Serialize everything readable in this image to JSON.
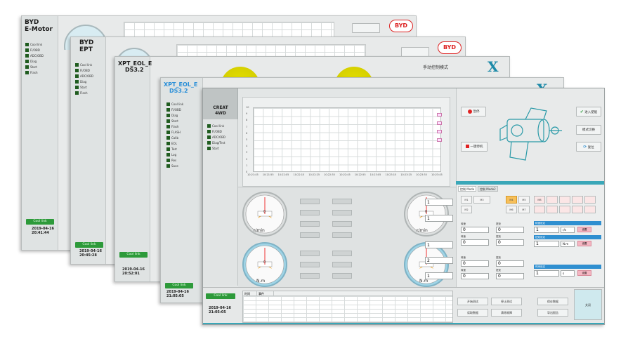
{
  "colors": {
    "accent_teal": "#3aa7b8",
    "status_green": "#2d9a3a",
    "gauge_yellow": "#d6d000",
    "mode_orange": "#f7c05a",
    "header_blue": "#2f8fd0"
  },
  "w1": {
    "brand": [
      "BYD",
      "E-Motor"
    ],
    "date": "2019-04-16",
    "time": "20:41:44",
    "status": "Cool link",
    "logo": "BYD",
    "nav": [
      "Cool link",
      "FI/OBD",
      "ADC/OBD",
      "Diag",
      "Start",
      "Flash"
    ]
  },
  "w2": {
    "brand": [
      "BYD",
      "EPT"
    ],
    "date": "2019-04-16",
    "time": "20:45:28",
    "status": "Cool link",
    "logo": "BYD",
    "nav": [
      "Cool link",
      "FI/OBD",
      "ADC/OBD",
      "Diag",
      "Start",
      "Flash"
    ]
  },
  "w3": {
    "brand": [
      "XPT_EOL_E",
      "DS3.2"
    ],
    "date": "2019-04-16",
    "time": "20:52:01",
    "status": "Cool link",
    "title": "手动控制模式",
    "logo": "X"
  },
  "w4": {
    "brand": [
      "XPT_EOL_E",
      "DS3.2"
    ],
    "date": "2019-04-16",
    "time": "21:05:05",
    "status": "Cool link",
    "logo": "X",
    "nav": [
      "Cool link",
      "FI/OBD",
      "Diag",
      "Start",
      "Flash",
      "FLASH",
      "Calib",
      "EOL",
      "Test",
      "Log",
      "Res",
      "Save"
    ]
  },
  "w5": {
    "brand": [
      "CREAT",
      "4WD"
    ],
    "date": "2019-04-16",
    "time": "21:05:05",
    "status": "Cool link",
    "nav": [
      "Cool link",
      "FI/OBD",
      "ADC/OBD",
      "Diag/Test",
      "Start"
    ],
    "graph": {
      "y_ticks": [
        "10",
        "9",
        "8",
        "7",
        "6",
        "5",
        "4",
        "3",
        "2",
        "1",
        "0"
      ],
      "x_ticks": [
        "10:21:45",
        "10:21:55",
        "10:22:05",
        "10:22:15",
        "10:22:25",
        "10:22:35",
        "10:22:45",
        "10:22:55",
        "10:23:05",
        "10:23:15",
        "10:23:25",
        "10:23:35",
        "10:23:45"
      ]
    },
    "gauges": [
      {
        "label": "r/min",
        "value": "0"
      },
      {
        "label": "r/min",
        "value": "0"
      },
      {
        "label": "N.m",
        "value": "0"
      },
      {
        "label": "N.m",
        "value": "0"
      }
    ],
    "readouts": [
      "1",
      "1",
      "1",
      "2",
      "1",
      "1"
    ],
    "right": {
      "btn_stop": "急停",
      "btn_key": "一键停机",
      "btn_enable": "进入使能",
      "btn_mode": "模式切换",
      "btn_reset": "复位"
    },
    "tabs": [
      "控制 Mode",
      "控制 Mode2"
    ],
    "modes": [
      "M1",
      "M2",
      "M3",
      "M4",
      "M5",
      "M6",
      "M7",
      "M8"
    ],
    "fields": [
      {
        "label": "转速",
        "value": "0"
      },
      {
        "label": "扭矩",
        "value": "0"
      },
      {
        "label": "转速",
        "value": "0"
      },
      {
        "label": "扭矩",
        "value": "0"
      },
      {
        "label": "转速",
        "value": "0"
      },
      {
        "label": "扭矩",
        "value": "0"
      },
      {
        "label": "转速",
        "value": "0"
      },
      {
        "label": "扭矩",
        "value": "0"
      }
    ],
    "set_fields": [
      {
        "header": "转速设定",
        "value": "1",
        "unit": "r/s",
        "btn": "设置"
      },
      {
        "header": "扭矩设定",
        "value": "1",
        "unit": "N.m",
        "btn": "设置"
      },
      {
        "header": "时间设定",
        "value": "1",
        "unit": "s",
        "btn": "设置"
      }
    ],
    "bottom_btns": [
      "开始测试",
      "停止测试",
      "保存数据",
      "读取数据",
      "清除故障",
      "导出报告",
      "关闭"
    ],
    "log_header": [
      "时间",
      "事件"
    ]
  }
}
